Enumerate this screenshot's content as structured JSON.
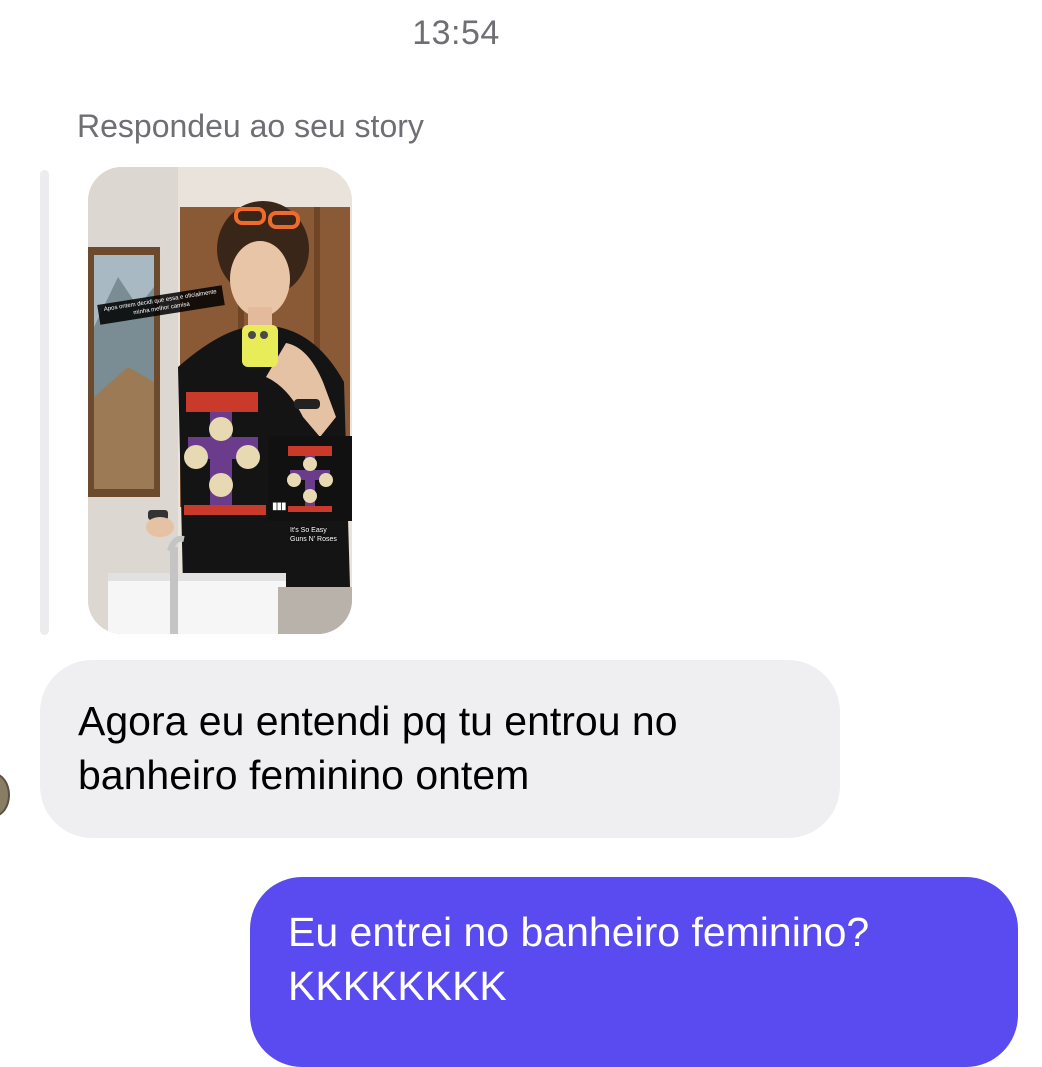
{
  "thread": {
    "timestamp": "13:54",
    "reply_context_label": "Respondeu ao seu story"
  },
  "story": {
    "caption_sticker": "Apos ontem decidi que essa e oficialmente minha melhor camisa",
    "music": {
      "song": "It's So Easy",
      "artist": "Guns N' Roses"
    }
  },
  "messages": [
    {
      "direction": "received",
      "lines": [
        "Agora eu entendi pq tu entrou no",
        "banheiro feminino ontem"
      ]
    },
    {
      "direction": "sent",
      "lines": [
        "Eu entrei no banheiro feminino?",
        "KKKKKKKK"
      ]
    }
  ],
  "colors": {
    "sent_bubble": "#5a4bf0",
    "received_bubble": "#efeff1",
    "meta_text": "#6e6e73"
  }
}
